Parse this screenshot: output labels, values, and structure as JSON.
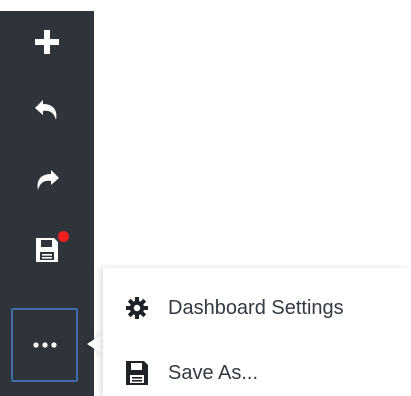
{
  "toolbar": {
    "buttons": [
      {
        "icon": "plus-icon"
      },
      {
        "icon": "undo-icon"
      },
      {
        "icon": "redo-icon"
      },
      {
        "icon": "save-icon",
        "unsaved_indicator": true
      },
      {
        "icon": "more-icon"
      }
    ]
  },
  "menu": {
    "items": [
      {
        "label": "Dashboard Settings",
        "icon": "gear-icon"
      },
      {
        "label": "Save As...",
        "icon": "save-icon"
      }
    ]
  },
  "colors": {
    "toolbar_bg": "#2f343b",
    "icon": "#ffffff",
    "active_border": "#3e6da8",
    "badge": "#f01f1f",
    "menu_text": "#333a42"
  }
}
